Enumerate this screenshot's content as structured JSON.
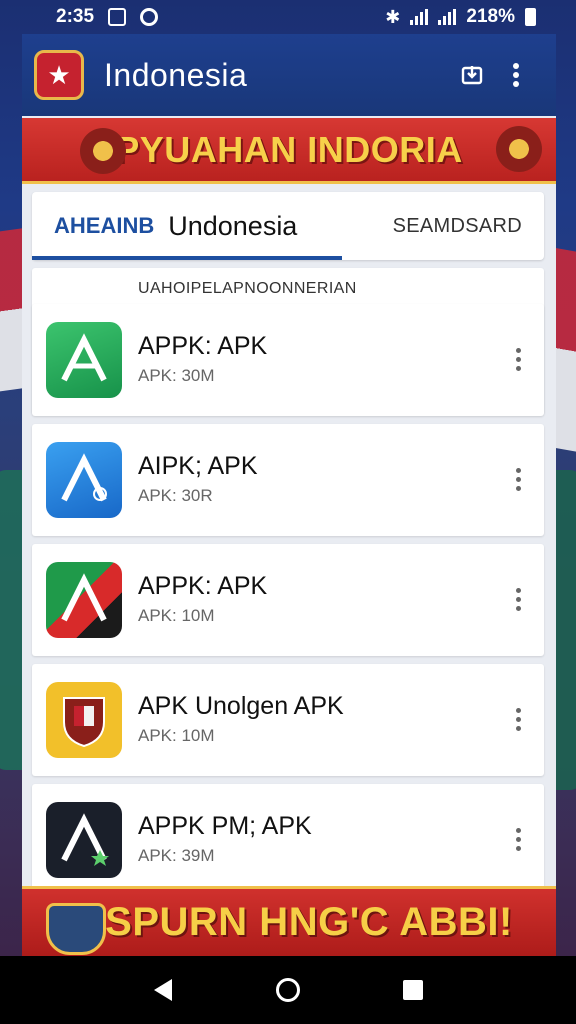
{
  "status_bar": {
    "time": "2:35",
    "battery": "218%"
  },
  "app_bar": {
    "title": "Indonesia",
    "logo_glyph": "★"
  },
  "banner_top": {
    "text": "PYUAHAN INDORIA"
  },
  "tabs": {
    "active": "AHEAINB",
    "title": "Undonesia",
    "search": "SEAMDSARD"
  },
  "section": {
    "label": "UAHOIPELAPNOONNERIAN"
  },
  "apps": [
    {
      "name": "APPK: APK",
      "size": "APK: 30M",
      "icon": "apk-green-icon"
    },
    {
      "name": "AIPK; APK",
      "size": "APK: 30R",
      "icon": "apk-blue-icon"
    },
    {
      "name": "APPK: APK",
      "size": "APK: 10M",
      "icon": "apk-flag-icon"
    },
    {
      "name": "APK Unolgen APK",
      "size": "APK: 10M",
      "icon": "apk-emblem-icon"
    },
    {
      "name": "APPK PM; APK",
      "size": "APK: 39M",
      "icon": "apk-dark-icon"
    }
  ],
  "banner_bottom": {
    "text": "SPURN HNG'C ABBI!"
  },
  "colors": {
    "primary": "#1e3f8e",
    "accent_red": "#c5222f",
    "accent_gold": "#f0c04a"
  }
}
